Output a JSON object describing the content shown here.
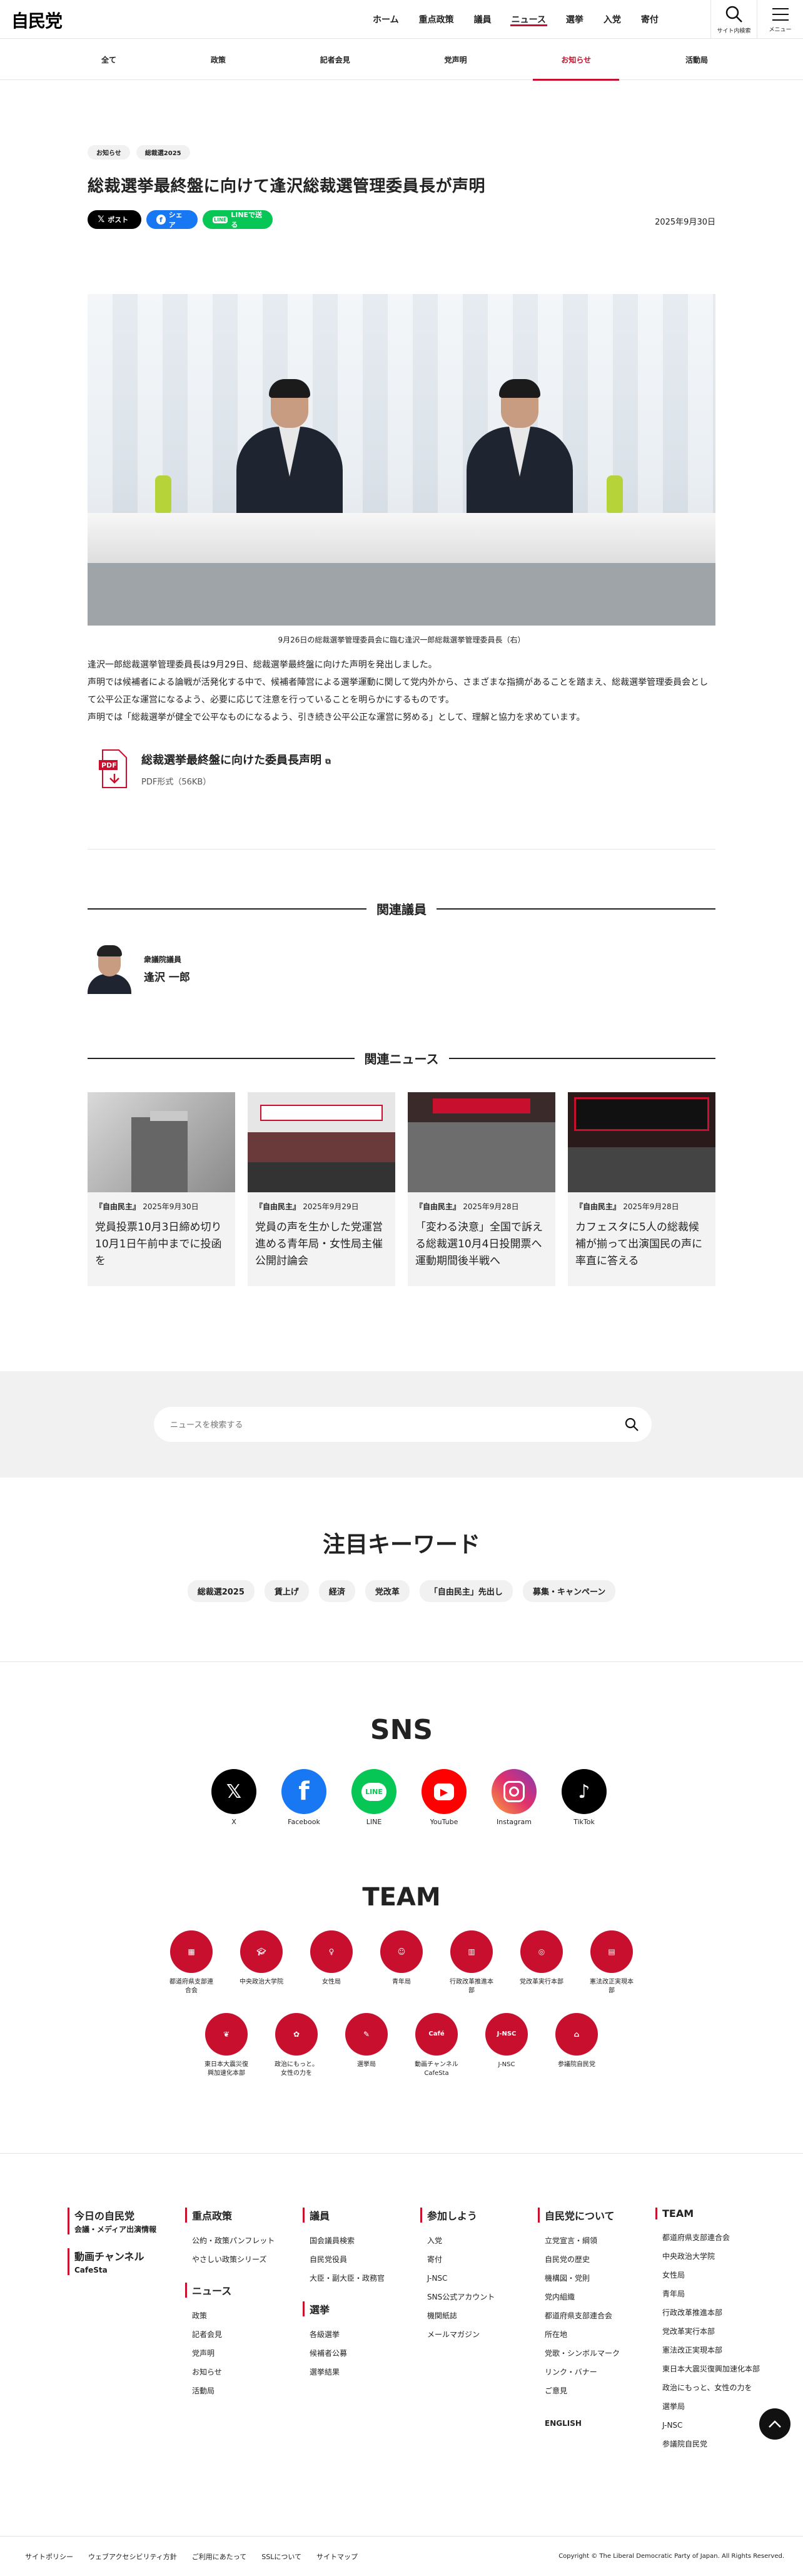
{
  "header": {
    "logo": "自民党",
    "nav": [
      "ホーム",
      "重点政策",
      "議員",
      "ニュース",
      "選挙",
      "入党",
      "寄付"
    ],
    "active_nav": "ニュース",
    "search_label": "サイト内検索",
    "menu_label": "メニュー"
  },
  "subnav": {
    "items": [
      "全て",
      "政策",
      "記者会見",
      "党声明",
      "お知らせ",
      "活動局"
    ],
    "active": "お知らせ"
  },
  "article": {
    "tags": [
      "お知らせ",
      "総裁選2025"
    ],
    "title": "総裁選挙最終盤に向けて逢沢総裁選管理委員長が声明",
    "share": {
      "x": "ポスト",
      "facebook": "シェア",
      "line": "LINEで送る"
    },
    "date": "2025年9月30日",
    "caption": "9月26日の総裁選挙管理委員会に臨む逢沢一郎総裁選挙管理委員長（右）",
    "paragraphs": [
      "逢沢一郎総裁選挙管理委員長は9月29日、総裁選挙最終盤に向けた声明を発出しました。",
      "声明では候補者による論戦が活発化する中で、候補者陣営による選挙運動に関して党内外から、さまざまな指摘があることを踏まえ、総裁選挙管理委員会として公平公正な運営になるよう、必要に応じて注意を行っていることを明らかにするものです。",
      "声明では「総裁選挙が健全で公平なものになるよう、引き続き公平公正な運営に努める」として、理解と協力を求めています。"
    ],
    "pdf": {
      "title": "総裁選挙最終盤に向けた委員長声明",
      "meta": "PDF形式（56KB）"
    }
  },
  "related_members": {
    "heading": "関連議員",
    "items": [
      {
        "role": "衆議院議員",
        "name": "逢沢 一郎"
      }
    ]
  },
  "related_news": {
    "heading": "関連ニュース",
    "items": [
      {
        "source": "『自由民主』",
        "date": "2025年9月30日",
        "title": "党員投票10月3日締め切り 10月1日午前中までに投函を"
      },
      {
        "source": "『自由民主』",
        "date": "2025年9月29日",
        "title": "党員の声を生かした党運営進める青年局・女性局主催公開討論会"
      },
      {
        "source": "『自由民主』",
        "date": "2025年9月28日",
        "title": "「変わる決意」全国で訴える総裁選10月4日投開票へ運動期間後半戦へ"
      },
      {
        "source": "『自由民主』",
        "date": "2025年9月28日",
        "title": "カフェスタに5人の総裁候補が揃って出演国民の声に率直に答える"
      }
    ]
  },
  "search": {
    "placeholder": "ニュースを検索する"
  },
  "keywords": {
    "heading": "注目キーワード",
    "items": [
      "総裁選2025",
      "賃上げ",
      "経済",
      "党改革",
      "「自由民主」先出し",
      "募集・キャンペーン"
    ]
  },
  "sns": {
    "heading": "SNS",
    "items": [
      "X",
      "Facebook",
      "LINE",
      "YouTube",
      "Instagram",
      "TikTok"
    ]
  },
  "team": {
    "heading": "TEAM",
    "row1": [
      "都道府県支部連合会",
      "中央政治大学院",
      "女性局",
      "青年局",
      "行政改革推進本部",
      "党改革実行本部",
      "憲法改正実現本部"
    ],
    "row2": [
      "東日本大震災復興加速化本部",
      "政治にもっと。女性の力を",
      "選挙局",
      "動画チャンネルCafeSta",
      "J-NSC",
      "参議院自民党"
    ]
  },
  "footer": {
    "col1": {
      "head": "今日の自民党",
      "links": [
        "会議・メディア出演情報"
      ],
      "head2": "動画チャンネル",
      "links2": [
        "CafeSta"
      ]
    },
    "col2": {
      "head": "重点政策",
      "links": [
        "公約・政策パンフレット",
        "やさしい政策シリーズ"
      ],
      "head2": "ニュース",
      "links2": [
        "政策",
        "記者会見",
        "党声明",
        "お知らせ",
        "活動局"
      ]
    },
    "col3": {
      "head": "議員",
      "links": [
        "国会議員検索",
        "自民党役員",
        "大臣・副大臣・政務官"
      ],
      "head2": "選挙",
      "links2": [
        "各級選挙",
        "候補者公募",
        "選挙結果"
      ]
    },
    "col4": {
      "head": "参加しよう",
      "links": [
        "入党",
        "寄付",
        "J-NSC",
        "SNS公式アカウント",
        "機関紙誌",
        "メールマガジン"
      ]
    },
    "col5": {
      "head": "自民党について",
      "links": [
        "立党宣言・綱領",
        "自民党の歴史",
        "機構図・党則",
        "党内組織",
        "都道府県支部連合会",
        "所在地",
        "党歌・シンボルマーク",
        "リンク・バナー",
        "ご意見"
      ],
      "english": "ENGLISH"
    },
    "col6": {
      "head": "TEAM",
      "links": [
        "都道府県支部連合会",
        "中央政治大学院",
        "女性局",
        "青年局",
        "行政改革推進本部",
        "党改革実行本部",
        "憲法改正実現本部",
        "東日本大震災復興加速化本部",
        "政治にもっと、女性の力を",
        "選挙局",
        "J-NSC",
        "参議院自民党"
      ]
    },
    "bottom_links": [
      "サイトポリシー",
      "ウェブアクセシビリティ方針",
      "ご利用にあたって",
      "SSLについて",
      "サイトマップ"
    ],
    "copyright": "Copyright © The Liberal Democratic Party of Japan. All Rights Reserved."
  }
}
